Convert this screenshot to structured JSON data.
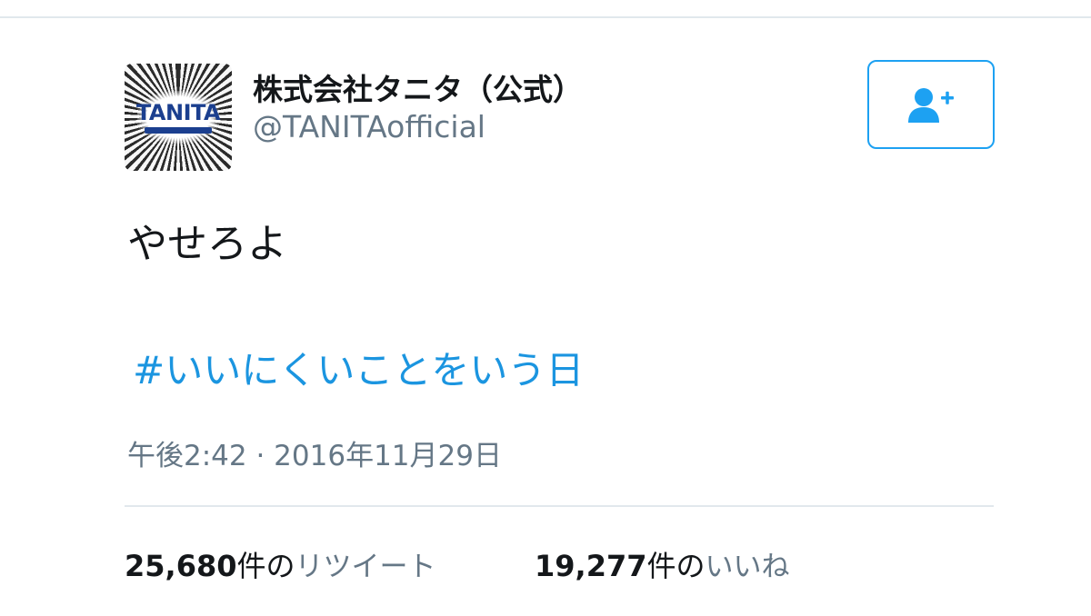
{
  "tweet": {
    "author": {
      "display_name": "株式会社タニタ（公式）",
      "handle": "@TANITAofficial",
      "avatar_logo_text": "TANITA"
    },
    "follow_icon": "add-user-icon",
    "text": "やせろよ",
    "hashtag": "#いいにくいことをいう日",
    "timestamp": "午後2:42 · 2016年11月29日",
    "stats": {
      "retweets": {
        "count": "25,680",
        "unit": "件の",
        "label": "リツイート"
      },
      "likes": {
        "count": "19,277",
        "unit": "件の",
        "label": "いいね"
      }
    }
  },
  "colors": {
    "accent": "#1da1f2",
    "hashtag": "#1b95e0",
    "secondary_text": "#657786",
    "divider": "#e1e8ed",
    "logo_blue": "#1b3f8f"
  }
}
